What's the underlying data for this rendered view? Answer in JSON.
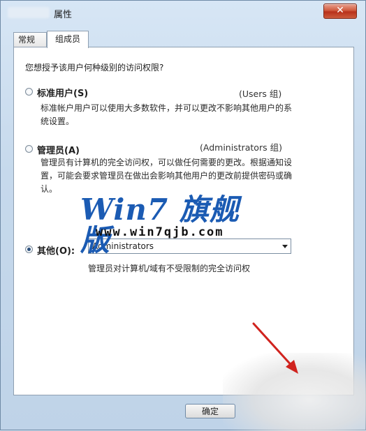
{
  "window": {
    "title": "属性",
    "close_glyph": "✕"
  },
  "tabs": [
    {
      "label": "常规"
    },
    {
      "label": "组成员"
    }
  ],
  "question": "您想授予该用户何种级别的访问权限?",
  "options": {
    "standard": {
      "label": "标准用户(S)",
      "group_hint": "(Users 组)",
      "desc": "标准帐户用户可以使用大多数软件，并可以更改不影响其他用户的系统设置。",
      "selected": false
    },
    "admin": {
      "label": "管理员(A)",
      "group_hint": "(Administrators 组)",
      "desc": "管理员有计算机的完全访问权，可以做任何需要的更改。根据通知设置，可能会要求管理员在做出会影响其他用户的更改前提供密码或确认。",
      "selected": false
    },
    "other": {
      "label": "其他(O):",
      "select_value": "Administrators",
      "desc": "管理员对计算机/域有不受限制的完全访问权",
      "selected": true
    }
  },
  "watermark": {
    "logo": "Win7 旗舰版",
    "url": "www.win7qjb.com"
  },
  "buttons": {
    "ok": "确定"
  },
  "colors": {
    "accent": "#1b5bb3",
    "arrow": "#d0231e",
    "close": "#c8412a"
  }
}
